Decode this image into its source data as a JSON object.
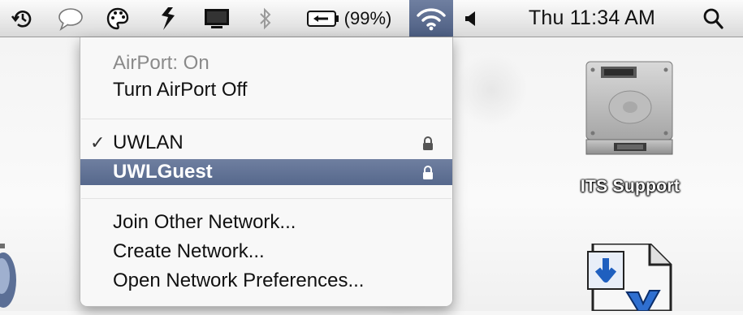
{
  "menubar": {
    "items": [
      {
        "name": "time-machine-icon"
      },
      {
        "name": "ichat-bubble-icon"
      },
      {
        "name": "palette-icon"
      },
      {
        "name": "script-icon"
      },
      {
        "name": "display-icon"
      },
      {
        "name": "bluetooth-icon"
      },
      {
        "name": "battery-icon"
      },
      {
        "name": "wifi-icon"
      },
      {
        "name": "volume-icon"
      },
      {
        "name": "spotlight-icon"
      }
    ],
    "battery_percent": "(99%)",
    "clock": "Thu 11:34 AM",
    "highlight_color": "#56688c"
  },
  "airport_menu": {
    "status": "AirPort: On",
    "toggle": "Turn AirPort Off",
    "networks": [
      {
        "name": "UWLAN",
        "checked": true,
        "locked": true
      },
      {
        "name": "UWLGuest",
        "checked": false,
        "locked": true,
        "highlighted": true
      }
    ],
    "checkmark": "✓",
    "join_other": "Join Other Network...",
    "create": "Create Network...",
    "preferences": "Open Network Preferences..."
  },
  "desktop": {
    "icons": [
      {
        "label": "ITS Support",
        "icon": "hard-drive-icon"
      },
      {
        "label": "",
        "icon": "installer-package-icon"
      }
    ]
  }
}
